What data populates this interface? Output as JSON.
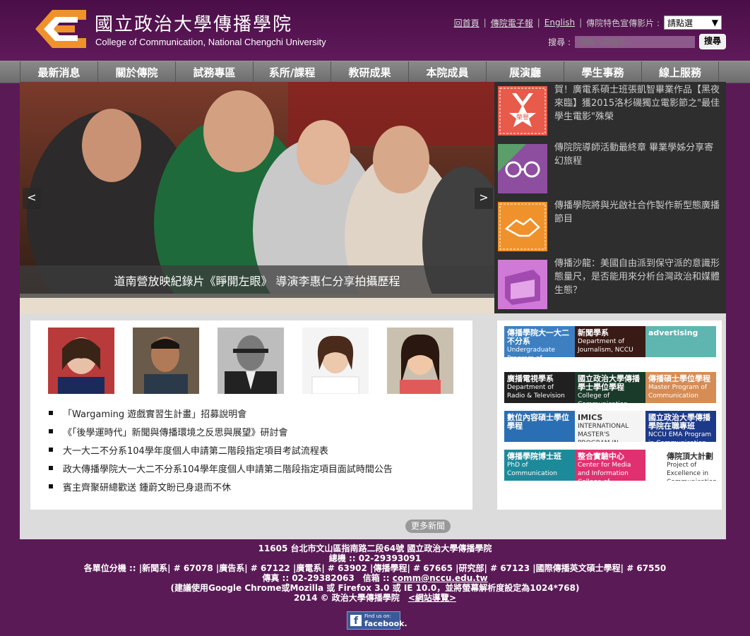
{
  "header": {
    "title_cn": "國立政治大學傳播學院",
    "title_en": "College of Communication, National Chengchi University",
    "links": [
      "回首頁",
      "傳院電子報",
      "English"
    ],
    "video_label": "傳院特色宣傳影片 :",
    "video_select_value": "請點選",
    "search_label": "搜尋 :",
    "search_placeholder": "請輸入關鍵字",
    "search_button": "搜尋"
  },
  "nav": [
    "最新消息",
    "關於傳院",
    "試務專區",
    "系所/課程",
    "教研成果",
    "本院成員",
    "展演廳",
    "學生事務",
    "線上服務"
  ],
  "hero": {
    "caption": "道南營放映紀錄片《睜開左眼》 導演李惠仁分享拍攝歷程",
    "prev": "<",
    "next": ">"
  },
  "side_news": [
    {
      "text": "賀！廣電系碩士班張凱智畢業作品【黑夜來臨】獲2015洛杉磯獨立電影節之\"最佳學生電影\"殊榮",
      "badge": "榮譽"
    },
    {
      "text": "傳院院導師活動最終章 畢業學姊分享寄幻旅程"
    },
    {
      "text": "傳播學院將與光啟社合作製作新型態廣播節目"
    },
    {
      "text": "傳播沙龍：美國自由派到保守派的意識形態量尺，是否能用來分析台灣政治和媒體生態？"
    }
  ],
  "news_list": [
    "「Wargaming 遊戲實習生計畫」招募說明會",
    "《「後學運時代」新聞與傳播環境之反思與展望》研討會",
    "大一大二不分系104學年度個人申請第二階段指定項目考試流程表",
    "政大傳播學院大一大二不分系104學年度個人申請第二階段指定項目面試時間公告",
    "賓主齊聚研總歡送 鍾蔚文盼已身退而不休"
  ],
  "more_news": "更多新聞",
  "banners": [
    {
      "title": "傳播學院大一大二不分系",
      "sub": "Undergraduate Program of Communication",
      "color": "#3d7fc1"
    },
    {
      "title": "新聞學系",
      "sub": "Department of Journalism, NCCU",
      "color": "#3a1a14"
    },
    {
      "title": "advertising",
      "sub": "",
      "color": "#5fb5b0"
    },
    {
      "title": "廣播電視學系",
      "sub": "Department of Radio & Television",
      "color": "#202020"
    },
    {
      "title": "國立政治大學傳播學士學位學程",
      "sub": "College of Communication Undergraduate Degree Program (CCUDP)",
      "color": "#1a3a2a"
    },
    {
      "title": "傳播碩士學位學程",
      "sub": "Master Program of Communication",
      "color": "#d58c55"
    },
    {
      "title": "數位內容碩士學位學程",
      "sub": "",
      "color": "#2a6fb3"
    },
    {
      "title": "IMICS",
      "sub": "INTERNATIONAL MASTER'S PROGRAM IN INTERNATIONAL COMMUNICATION STUDIES",
      "color": "#f4f4f4"
    },
    {
      "title": "國立政治大學傳播學院在職專班",
      "sub": "NCCU EMA Program in Communication",
      "color": "#1d3a8a"
    },
    {
      "title": "傳播學院博士班",
      "sub": "PhD of Communication",
      "color": "#1d8a9a"
    },
    {
      "title": "整合實驗中心",
      "sub": "Center for Media and Information College of Communication, NCCU",
      "color": "#e0306f"
    },
    {
      "title": "傳院頂大計劃",
      "sub": "Project of Excellence in Communication",
      "color": "#ffffff"
    }
  ],
  "footer": {
    "address": "11605 台北市文山區指南路二段64號 國立政治大學傳播學院",
    "phone": "總機 :: 02-29393091",
    "ext": "各單位分機 :: |新聞系| # 67078 |廣告系| # 67122 |廣電系| # 63902 |傳播學程| # 67665 |研究部| # 67123 |國際傳播英文碩士學程| # 67550",
    "fax_label": "傳真 :: 02-29382063　信箱 :: ",
    "email": "comm@nccu.edu.tw",
    "browser": "(建議使用Google Chrome或Mozilla 或 Firefox 3.0 或 IE 10.0，並將螢幕解析度設定為1024*768)",
    "copyright": "2014 © 政治大學傳播學院　",
    "sitemap": "<網站導覽>",
    "fb_small": "Find us on:",
    "fb_big": "facebook."
  },
  "colors": {
    "bg": "#5a1a56",
    "accent_orange": "#f0922c"
  }
}
